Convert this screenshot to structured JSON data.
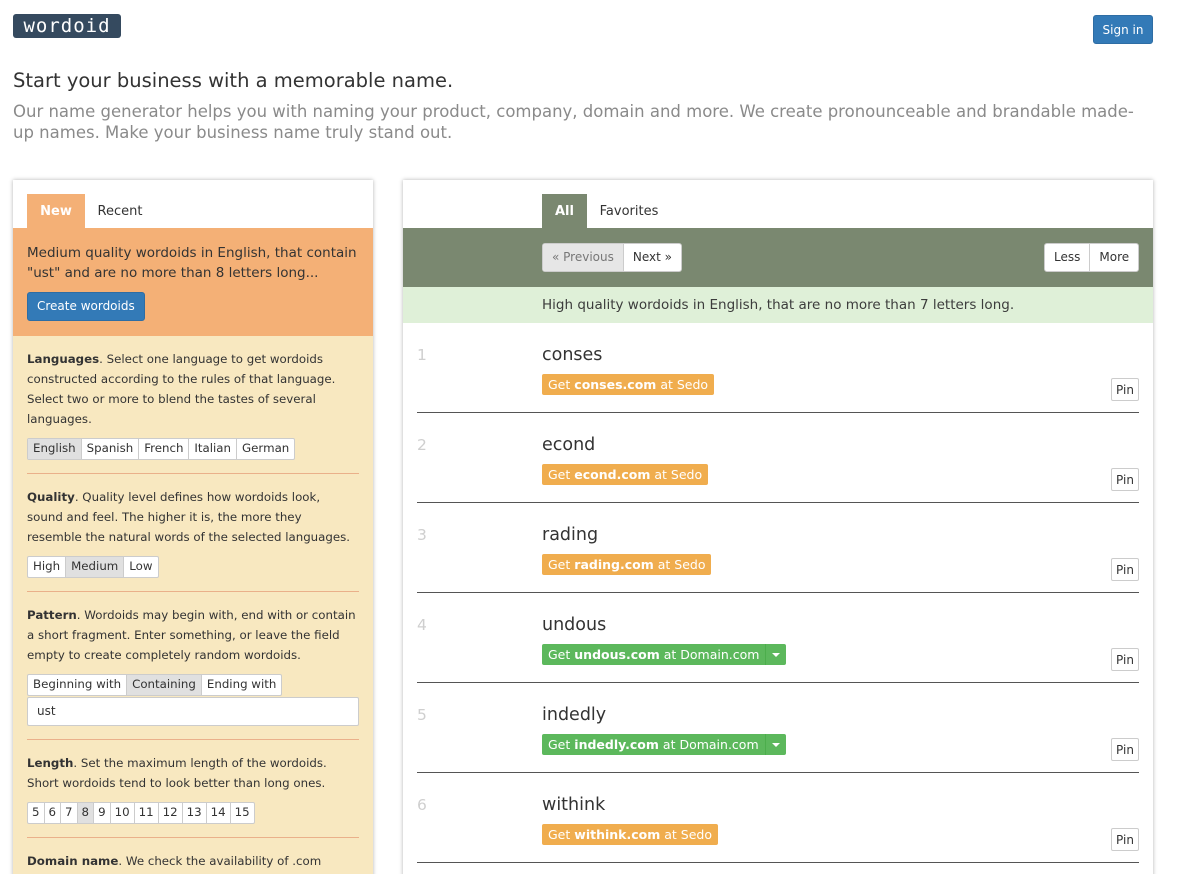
{
  "header": {
    "logo_text": "wordoid",
    "signin_label": "Sign in"
  },
  "intro": {
    "headline": "Start your business with a memorable name.",
    "subline": "Our name generator helps you with naming your product, company, domain and more. We create pronounceable and brandable made-up names. Make your business name truly stand out."
  },
  "left": {
    "tabs": [
      "New",
      "Recent"
    ],
    "summary": "Medium quality wordoids in English, that contain \"ust\" and are no more than 8 letters long...",
    "create_label": "Create wordoids",
    "languages": {
      "title": "Languages",
      "text": ". Select one language to get wordoids constructed according to the rules of that language. Select two or more to blend the tastes of several languages.",
      "options": [
        "English",
        "Spanish",
        "French",
        "Italian",
        "German"
      ],
      "selected": "English"
    },
    "quality": {
      "title": "Quality",
      "text": ". Quality level defines how wordoids look, sound and feel. The higher it is, the more they resemble the natural words of the selected languages.",
      "options": [
        "High",
        "Medium",
        "Low"
      ],
      "selected": "Medium"
    },
    "pattern": {
      "title": "Pattern",
      "text": ". Wordoids may begin with, end with or contain a short fragment. Enter something, or leave the field empty to create completely random wordoids.",
      "options": [
        "Beginning with",
        "Containing",
        "Ending with"
      ],
      "selected": "Containing",
      "value": "ust"
    },
    "length": {
      "title": "Length",
      "text": ". Set the maximum length of the wordoids. Short wordoids tend to look better than long ones.",
      "options": [
        "5",
        "6",
        "7",
        "8",
        "9",
        "10",
        "11",
        "12",
        "13",
        "14",
        "15"
      ],
      "selected": "8"
    },
    "domain": {
      "title": "Domain name",
      "text": ". We check the availability of .com domain"
    }
  },
  "right": {
    "tabs": [
      "All",
      "Favorites"
    ],
    "prev_label": "« Previous",
    "next_label": "Next »",
    "less_label": "Less",
    "more_label": "More",
    "info": "High quality wordoids in English, that are no more than 7 letters long.",
    "pin_label": "Pin",
    "results": [
      {
        "num": "1",
        "word": "conses",
        "pre": "Get",
        "domain": "conses.com",
        "post": "at Sedo",
        "kind": "sedo"
      },
      {
        "num": "2",
        "word": "econd",
        "pre": "Get",
        "domain": "econd.com",
        "post": "at Sedo",
        "kind": "sedo"
      },
      {
        "num": "3",
        "word": "rading",
        "pre": "Get",
        "domain": "rading.com",
        "post": "at Sedo",
        "kind": "sedo"
      },
      {
        "num": "4",
        "word": "undous",
        "pre": "Get",
        "domain": "undous.com",
        "post": "at Domain.com",
        "kind": "dom"
      },
      {
        "num": "5",
        "word": "indedly",
        "pre": "Get",
        "domain": "indedly.com",
        "post": "at Domain.com",
        "kind": "dom"
      },
      {
        "num": "6",
        "word": "withink",
        "pre": "Get",
        "domain": "withink.com",
        "post": "at Sedo",
        "kind": "sedo"
      }
    ]
  }
}
